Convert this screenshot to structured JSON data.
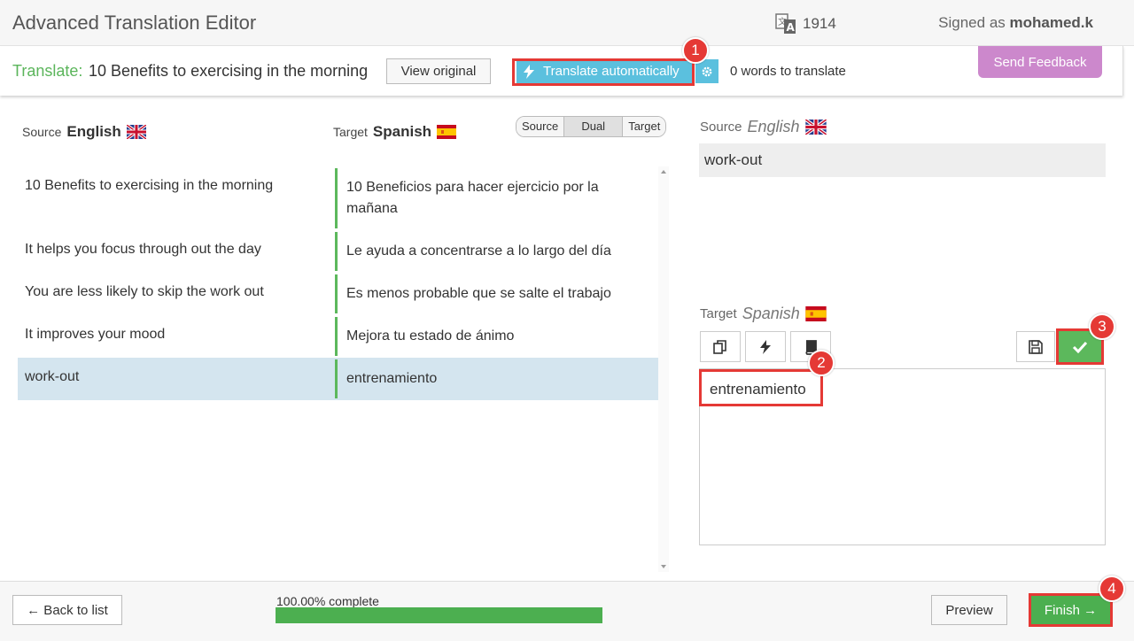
{
  "header": {
    "app_title": "Advanced Translation Editor",
    "credits": "1914",
    "signed_prefix": "Signed as",
    "username": "mohamed.k"
  },
  "toolbar": {
    "translate_label": "Translate:",
    "document_title": "10 Benefits to exercising in the morning",
    "view_original_label": "View original",
    "translate_auto_label": "Translate automatically",
    "words_to_translate": "0 words to translate",
    "feedback_label": "Send Feedback"
  },
  "segments_panel": {
    "source_caption": "Source",
    "source_language": "English",
    "target_caption": "Target",
    "target_language": "Spanish",
    "view_modes": [
      "Source",
      "Dual",
      "Target"
    ],
    "active_view_mode": "Dual",
    "rows": [
      {
        "source": "10 Benefits to exercising in the morning",
        "target": "10 Beneficios para hacer ejercicio por la mañana"
      },
      {
        "source": "It helps you focus through out the day",
        "target": "Le ayuda a concentrarse a lo largo del día"
      },
      {
        "source": "You are less likely to skip the work out",
        "target": "Es menos probable que se salte el trabajo"
      },
      {
        "source": "It improves your mood",
        "target": "Mejora tu estado de ánimo"
      },
      {
        "source": "work-out",
        "target": "entrenamiento"
      }
    ],
    "active_row": 4
  },
  "editor": {
    "source_caption": "Source",
    "source_language": "English",
    "source_text": "work-out",
    "target_caption": "Target",
    "target_language": "Spanish",
    "target_text": "entrenamiento"
  },
  "footer": {
    "back_label": "← Back to list",
    "progress_label": "100.00% complete",
    "progress_percent": 100,
    "preview_label": "Preview",
    "finish_label": "Finish →"
  },
  "annotations": [
    "1",
    "2",
    "3",
    "4"
  ],
  "colors": {
    "accent_green": "#5cb85c",
    "translate_blue": "#5bc0de",
    "feedback_purple": "#cc88cc",
    "highlight_red": "#e53935",
    "active_row": "#d4e5ef"
  }
}
